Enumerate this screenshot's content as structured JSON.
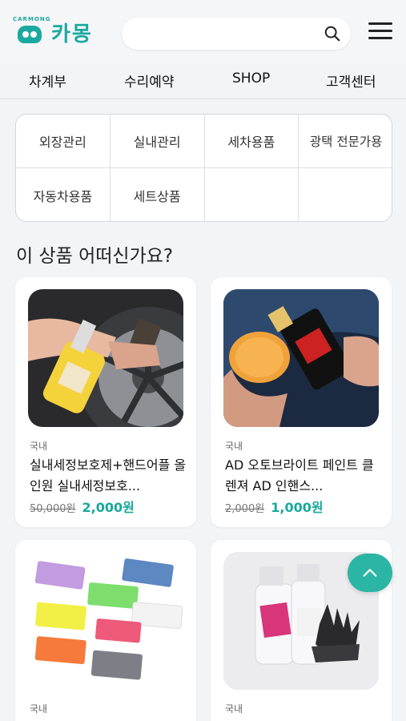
{
  "header": {
    "logo_text": "카몽",
    "logo_arc": "CARMONG",
    "search": {
      "value": "",
      "placeholder": ""
    }
  },
  "nav": {
    "items": [
      {
        "label": "차계부"
      },
      {
        "label": "수리예약"
      },
      {
        "label": "SHOP"
      },
      {
        "label": "고객센터"
      }
    ]
  },
  "categories": [
    {
      "label": "외장관리"
    },
    {
      "label": "실내관리"
    },
    {
      "label": "세차용품"
    },
    {
      "label": "광택 전문가용"
    },
    {
      "label": "자동차용품"
    },
    {
      "label": "세트상품"
    }
  ],
  "section": {
    "title": "이 상품 어떠신가요?"
  },
  "products": [
    {
      "origin": "국내",
      "name": "실내세정보호제+핸드어플 올인원 실내세정보호...",
      "original_price": "50,000원",
      "sale_price": "2,000원"
    },
    {
      "origin": "국내",
      "name": "AD 오토브라이트 페인트 클렌져 AD 인핸스...",
      "original_price": "2,000원",
      "sale_price": "1,000원"
    },
    {
      "origin": "국내",
      "name": "",
      "original_price": "",
      "sale_price": ""
    },
    {
      "origin": "국내",
      "name": "",
      "original_price": "",
      "sale_price": ""
    }
  ],
  "scroll_top": {
    "icon": "chevron-up-icon"
  },
  "colors": {
    "brand": "#1aa9a0",
    "sale_price": "#17a99a",
    "fab": "#2bb5a4"
  }
}
